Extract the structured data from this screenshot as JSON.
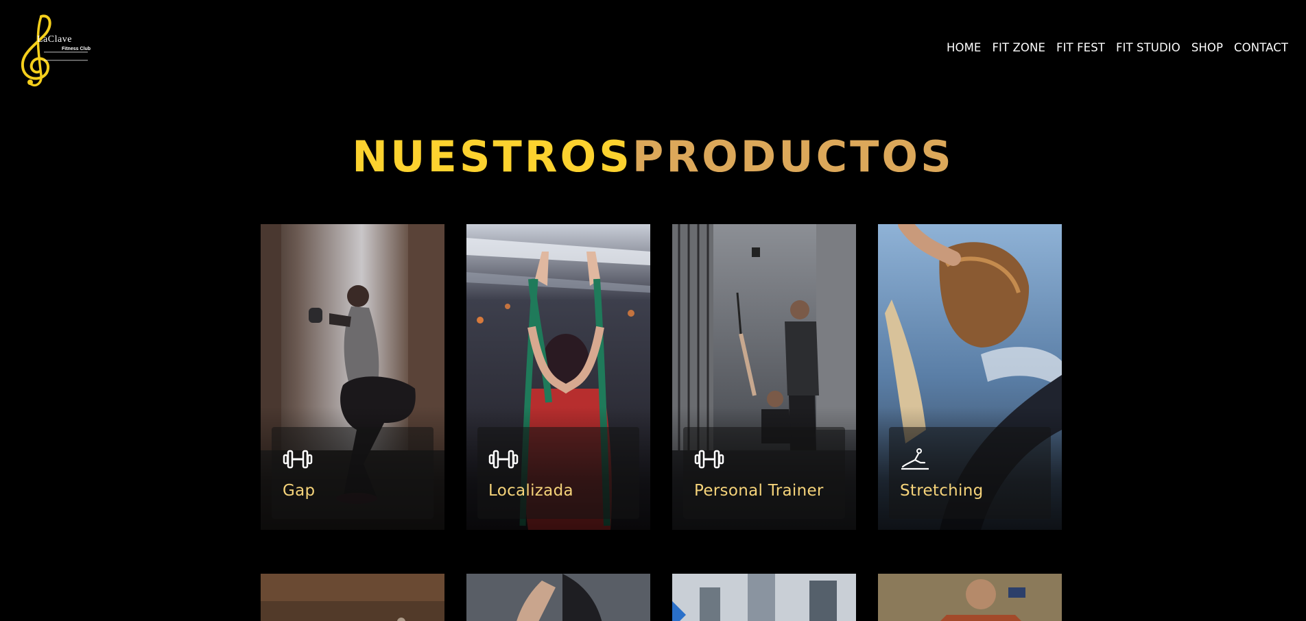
{
  "brand": {
    "logo_text": "LaClave",
    "logo_subtext": "Fitness Club"
  },
  "nav": {
    "items": [
      "HOME",
      "FIT ZONE",
      "FIT FEST",
      "FIT STUDIO",
      "SHOP",
      "CONTACT"
    ]
  },
  "section": {
    "title_part1": "NUESTROS",
    "title_part2": "PRODUCTOS"
  },
  "products": [
    {
      "label": "Gap",
      "icon": "dumbbell-icon"
    },
    {
      "label": "Localizada",
      "icon": "dumbbell-icon"
    },
    {
      "label": "Personal Trainer",
      "icon": "dumbbell-icon"
    },
    {
      "label": "Stretching",
      "icon": "stretching-icon"
    }
  ],
  "colors": {
    "background": "#000000",
    "title_primary": "#fcd22f",
    "title_secondary": "#dca85a",
    "card_label": "#f5d37a",
    "logo_gold": "#f5cf1c"
  }
}
